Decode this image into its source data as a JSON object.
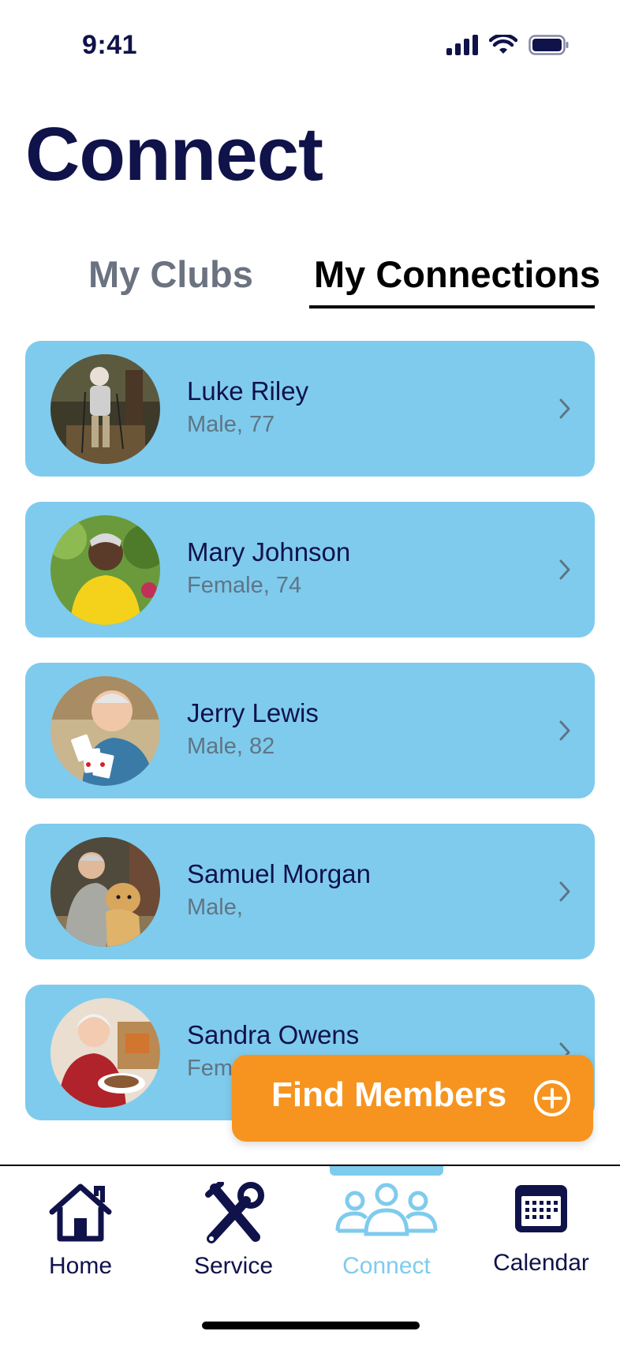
{
  "status_bar": {
    "time": "9:41",
    "icons": [
      "cellular-signal-icon",
      "wifi-icon",
      "battery-icon"
    ]
  },
  "page": {
    "title": "Connect"
  },
  "tabs": [
    {
      "label": "My Clubs",
      "active": false
    },
    {
      "label": "My Connections",
      "active": true
    }
  ],
  "members": [
    {
      "name": "Luke Riley",
      "meta": "Male, 77"
    },
    {
      "name": "Mary Johnson",
      "meta": "Female, 74"
    },
    {
      "name": "Jerry Lewis",
      "meta": "Male, 82"
    },
    {
      "name": "Samuel Morgan",
      "meta": "Male,"
    },
    {
      "name": "Sandra Owens",
      "meta": "Fem"
    }
  ],
  "find_members": {
    "label": "Find Members",
    "icon": "plus-circle-icon"
  },
  "nav": {
    "items": [
      {
        "label": "Home",
        "icon": "home-icon",
        "active": false
      },
      {
        "label": "Service",
        "icon": "tools-icon",
        "active": false
      },
      {
        "label": "Connect",
        "icon": "people-icon",
        "active": true
      },
      {
        "label": "Calendar",
        "icon": "calendar-icon",
        "active": false
      }
    ]
  },
  "colors": {
    "navy": "#10124a",
    "card": "#7fcbed",
    "accent_orange": "#f6941f",
    "muted_text": "#5e7585",
    "active_nav": "#7fcbed"
  }
}
